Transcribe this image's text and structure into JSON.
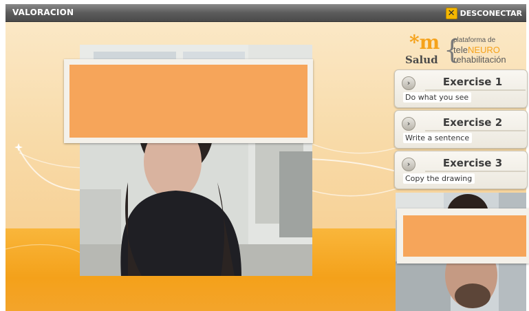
{
  "window": {
    "title": "VALORACION"
  },
  "toolbar": {
    "disconnect_label": "DESCONECTAR",
    "disconnect_icon": "close-x-icon",
    "accent": "#f5b700"
  },
  "logo": {
    "mark": "*m",
    "brand": "Salud",
    "line1": "plataforma de",
    "line2_prefix": "tele",
    "line2_highlight": "NEURO",
    "line3": "rehabilitación"
  },
  "exercises": [
    {
      "title": "Exercise 1",
      "description": "Do what you see"
    },
    {
      "title": "Exercise 2",
      "description": "Write a sentence"
    },
    {
      "title": "Exercise 3",
      "description": "Copy the drawing"
    }
  ],
  "colors": {
    "redaction": "#f6a55a",
    "floor": "#f4a11a",
    "background": "#f8dba9"
  }
}
